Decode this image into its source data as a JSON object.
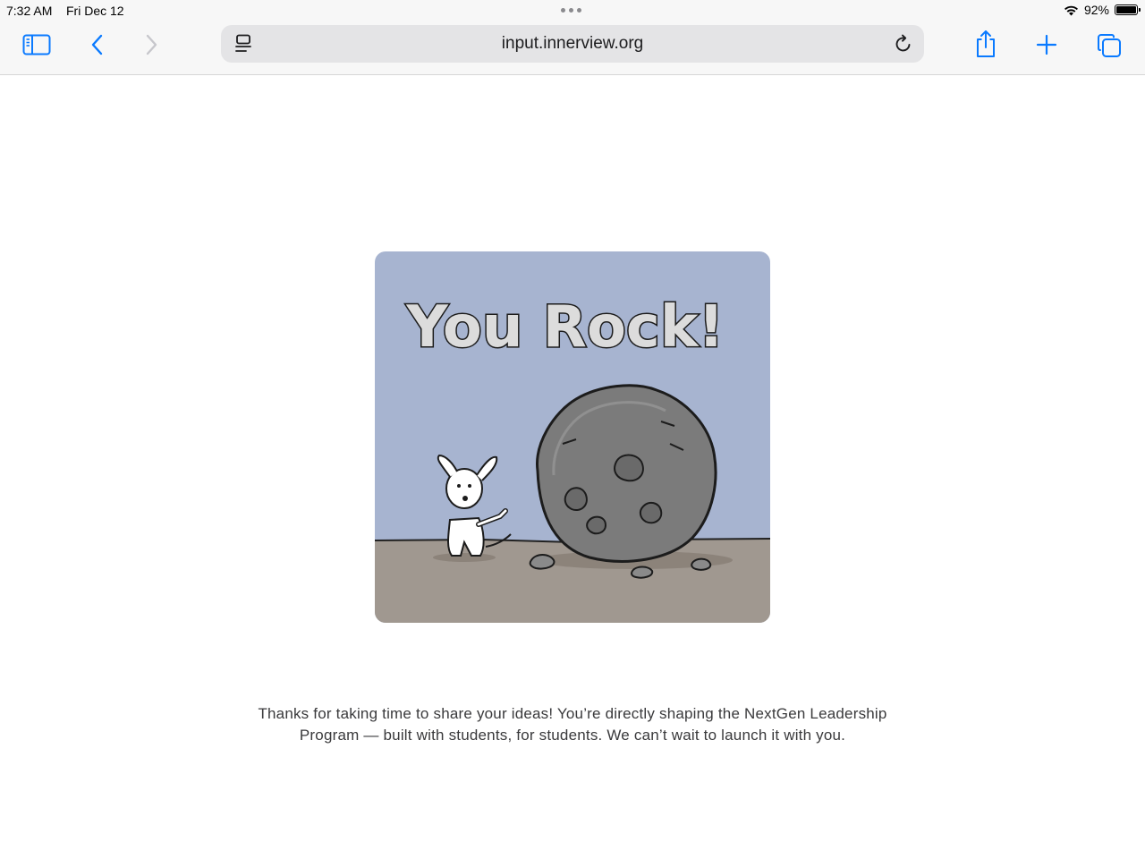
{
  "status_bar": {
    "time": "7:32 AM",
    "date": "Fri Dec 12",
    "battery_percent": "92%",
    "battery_level": 0.92
  },
  "toolbar": {
    "url": "input.innerview.org",
    "icons": [
      "sidebar-icon",
      "back-chevron-icon",
      "forward-chevron-icon",
      "reader-icon",
      "reload-icon",
      "share-icon",
      "plus-icon",
      "tabs-icon"
    ],
    "accent_color": "#0a7aff"
  },
  "card": {
    "headline": "You Rock!",
    "sky_color": "#a7b4d0",
    "ground_color": "#a09890"
  },
  "message": {
    "text": "Thanks for taking  time to share your ideas! You’re directly shaping the NextGen Leadership\nProgram — built with students, for students. We can’t wait to launch it with you."
  }
}
